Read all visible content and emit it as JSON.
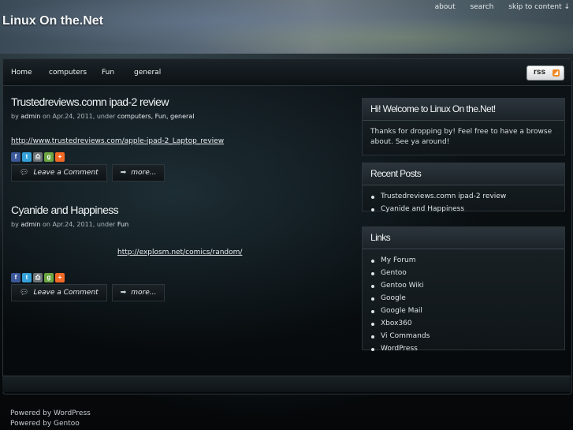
{
  "header": {
    "title": "Linux On the.Net",
    "links": [
      "about",
      "search",
      "skip to content ↓"
    ]
  },
  "nav": {
    "items": [
      "Home",
      "computers",
      "Fun",
      "general"
    ],
    "rss_label": "rss"
  },
  "posts": [
    {
      "title": "Trustedreviews.comn ipad-2 review",
      "meta_by": "by",
      "author": "admin",
      "meta_on": "on Apr.24, 2011, under",
      "categories": "computers, Fun, general",
      "link": "http://www.trustedreviews.com/apple-ipad-2_Laptop_review",
      "comment_label": "Leave a Comment",
      "more_label": "more..."
    },
    {
      "title": "Cyanide and Happiness",
      "meta_by": "by",
      "author": "admin",
      "meta_on": "on Apr.24, 2011, under",
      "categories": "Fun",
      "link": "http://explosm.net/comics/random/",
      "comment_label": "Leave a Comment",
      "more_label": "more..."
    }
  ],
  "share_icons": [
    "facebook-icon",
    "twitter-icon",
    "print-icon",
    "google-icon",
    "addthis-icon"
  ],
  "sidebar": {
    "welcome": {
      "title": "Hi! Welcome to Linux On the.Net!",
      "text": "Thanks for dropping by! Feel free to have a browse about. See ya around!"
    },
    "recent": {
      "title": "Recent Posts",
      "items": [
        "Trustedreviews.comn ipad-2 review",
        "Cyanide and Happiness"
      ]
    },
    "links": {
      "title": "Links",
      "items": [
        "My Forum",
        "Gentoo",
        "Gentoo Wiki",
        "Google",
        "Google Mail",
        "Xbox360",
        "Vi Commands",
        "WordPress"
      ]
    }
  },
  "footer": {
    "line1": "Powered by WordPress",
    "line2": "Powered by Gentoo"
  },
  "colors": {
    "share_facebook": "#3b5998",
    "share_twitter": "#33a1d8",
    "share_print": "#6d7478",
    "share_google": "#6ba642",
    "share_addthis": "#f26a25",
    "rss": "#f08a24"
  }
}
